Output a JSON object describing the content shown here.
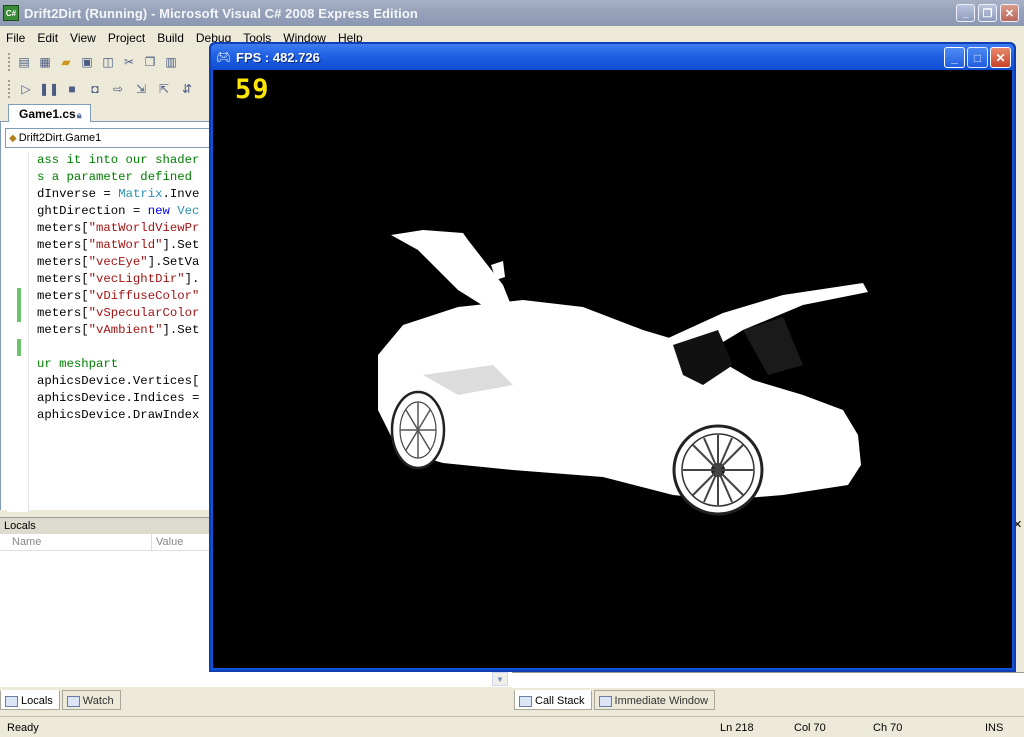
{
  "window": {
    "title": "Drift2Dirt (Running) - Microsoft Visual C# 2008 Express Edition",
    "icon": "csharp-app-icon",
    "controls": {
      "minimize": "_",
      "restore": "❐",
      "close": "✕"
    }
  },
  "menu": [
    "File",
    "Edit",
    "View",
    "Project",
    "Build",
    "Debug",
    "Tools",
    "Window",
    "Help"
  ],
  "document": {
    "tab_label": "Game1.cs",
    "class_selector": "Drift2Dirt.Game1"
  },
  "code_lines": [
    [
      {
        "t": "ass it into our shader",
        "c": "comment"
      }
    ],
    [
      {
        "t": "s a parameter defined",
        "c": "comment"
      }
    ],
    [
      {
        "t": "dInverse = ",
        "c": "plain"
      },
      {
        "t": "Matrix",
        "c": "type"
      },
      {
        "t": ".Inve",
        "c": "plain"
      }
    ],
    [
      {
        "t": "ghtDirection = ",
        "c": "plain"
      },
      {
        "t": "new",
        "c": "kw"
      },
      {
        "t": " ",
        "c": "plain"
      },
      {
        "t": "Vec",
        "c": "type"
      }
    ],
    [
      {
        "t": "meters[",
        "c": "plain"
      },
      {
        "t": "\"matWorldViewPr",
        "c": "string"
      }
    ],
    [
      {
        "t": "meters[",
        "c": "plain"
      },
      {
        "t": "\"matWorld\"",
        "c": "string"
      },
      {
        "t": "].Set",
        "c": "plain"
      }
    ],
    [
      {
        "t": "meters[",
        "c": "plain"
      },
      {
        "t": "\"vecEye\"",
        "c": "string"
      },
      {
        "t": "].SetVa",
        "c": "plain"
      }
    ],
    [
      {
        "t": "meters[",
        "c": "plain"
      },
      {
        "t": "\"vecLightDir\"",
        "c": "string"
      },
      {
        "t": "].",
        "c": "plain"
      }
    ],
    [
      {
        "t": "meters[",
        "c": "plain"
      },
      {
        "t": "\"vDiffuseColor\"",
        "c": "string"
      }
    ],
    [
      {
        "t": "meters[",
        "c": "plain"
      },
      {
        "t": "\"vSpecularColor",
        "c": "string"
      }
    ],
    [
      {
        "t": "meters[",
        "c": "plain"
      },
      {
        "t": "\"vAmbient\"",
        "c": "string"
      },
      {
        "t": "].Set",
        "c": "plain"
      }
    ],
    [],
    [
      {
        "t": "ur meshpart",
        "c": "comment"
      }
    ],
    [
      {
        "t": "aphicsDevice.Vertices[",
        "c": "plain"
      }
    ],
    [
      {
        "t": "aphicsDevice.Indices = ",
        "c": "plain"
      }
    ],
    [
      {
        "t": "aphicsDevice.DrawIndex",
        "c": "plain"
      }
    ]
  ],
  "locals": {
    "title": "Locals",
    "columns": [
      "Name",
      "Value"
    ]
  },
  "bottom_tabs_left": [
    {
      "label": "Locals",
      "active": true,
      "icon": "locals-icon"
    },
    {
      "label": "Watch",
      "active": false,
      "icon": "watch-icon"
    }
  ],
  "bottom_tabs_right": [
    {
      "label": "Call Stack",
      "active": true,
      "icon": "call-stack-icon"
    },
    {
      "label": "Immediate Window",
      "active": false,
      "icon": "immediate-window-icon"
    }
  ],
  "status": {
    "text": "Ready",
    "ln": "Ln 218",
    "col": "Col 70",
    "ch": "Ch 70",
    "mode": "INS"
  },
  "game_window": {
    "title": "FPS : 482.726",
    "frame_counter": "59",
    "icon": "xna-gamepad-icon",
    "scene": "white-lit sports car on black background"
  },
  "colors": {
    "vs_titlebar": "#97a2ba",
    "game_titlebar": "#2264e5",
    "frame_counter": "#ffe600",
    "comment": "#008000",
    "string": "#a31515",
    "type": "#2b91af",
    "keyword": "#0000ff"
  }
}
